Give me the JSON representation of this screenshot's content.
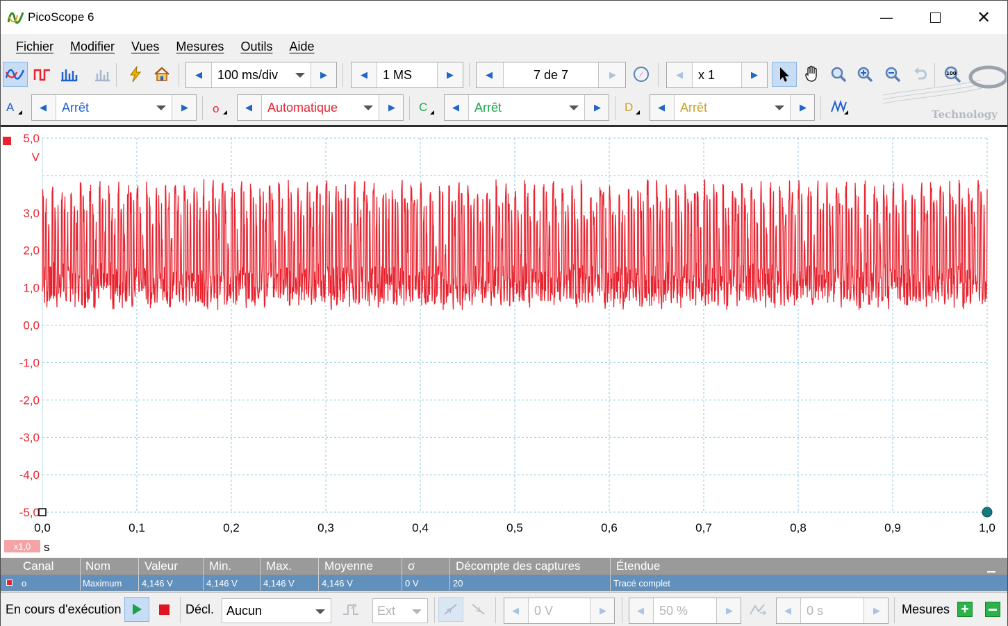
{
  "window": {
    "title": "PicoScope 6"
  },
  "menu": [
    "Fichier",
    "Modifier",
    "Vues",
    "Mesures",
    "Outils",
    "Aide"
  ],
  "toolbar": {
    "timebase": "100 ms/div",
    "samples": "1 MS",
    "capture": "7 de 7",
    "zoom": "x 1"
  },
  "channels": {
    "a": {
      "label": "A",
      "range": "Arrêt",
      "color": "#1f5fcf"
    },
    "o": {
      "label": "o",
      "range": "Automatique",
      "color": "#e8232f"
    },
    "c": {
      "label": "C",
      "range": "Arrêt",
      "color": "#1aa84a"
    },
    "d": {
      "label": "D",
      "range": "Arrêt",
      "color": "#c8a12a"
    }
  },
  "logo": {
    "text": "Technology"
  },
  "scope": {
    "y_unit": "V",
    "y_ticks": [
      "5,0",
      "3,0",
      "2,0",
      "1,0",
      "0,0",
      "-1,0",
      "-2,0",
      "-3,0",
      "-4,0",
      "-5,0"
    ],
    "x_ticks": [
      "0,0",
      "0,1",
      "0,2",
      "0,3",
      "0,4",
      "0,5",
      "0,6",
      "0,7",
      "0,8",
      "0,9",
      "1,0"
    ],
    "x_unit": "s",
    "x_multiplier": "x1,0",
    "trace_color": "#e8232f"
  },
  "measurements": {
    "headers": [
      "Canal",
      "Nom",
      "Valeur",
      "Min.",
      "Max.",
      "Moyenne",
      "σ",
      "Décompte des captures",
      "Étendue"
    ],
    "row": [
      "o",
      "Maximum",
      "4,146 V",
      "4,146 V",
      "4,146 V",
      "4,146 V",
      "0 V",
      "20",
      "Tracé complet"
    ]
  },
  "status": {
    "running": "En cours d'exécution",
    "trigger_label": "Décl.",
    "trigger_mode": "Aucun",
    "source": "Ext",
    "level": "0 V",
    "percent": "50 %",
    "delay": "0 s",
    "measures_label": "Mesures"
  },
  "chart_data": {
    "type": "line",
    "title": "",
    "xlabel": "s",
    "ylabel": "V",
    "xlim": [
      0.0,
      1.0
    ],
    "ylim": [
      -5.0,
      5.0
    ],
    "series": [
      {
        "name": "o",
        "description_note": "",
        "x": [
          0.0,
          0.01,
          0.02,
          0.03,
          0.04,
          0.05,
          0.06,
          0.07,
          0.08,
          0.09,
          0.1
        ],
        "values": [
          0.9,
          3.8,
          0.4,
          3.9,
          0.4,
          3.8,
          0.5,
          3.9,
          0.4,
          3.8,
          0.5
        ]
      }
    ],
    "grid": true
  }
}
